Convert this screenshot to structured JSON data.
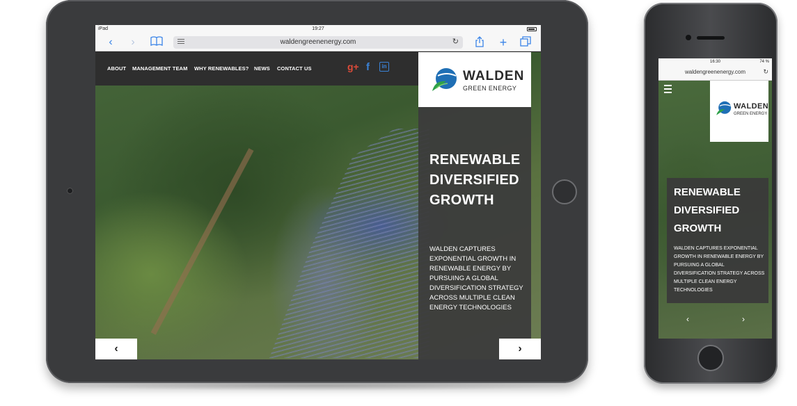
{
  "ipad": {
    "status": {
      "carrier": "iPad",
      "time": "19:27"
    },
    "toolbar": {
      "back_icon": "chevron-left-icon",
      "forward_icon": "chevron-right-icon",
      "bookmarks_icon": "book-icon",
      "url": "waldengreenenergy.com",
      "share_icon": "share-icon",
      "add_icon": "plus-icon",
      "tabs_icon": "tabs-icon"
    },
    "nav": {
      "items": [
        "ABOUT",
        "MANAGEMENT TEAM",
        "WHY RENEWABLES?",
        "NEWS",
        "CONTACT US"
      ],
      "social": [
        "g+",
        "f",
        "in"
      ]
    },
    "logo": {
      "name": "WALDEN",
      "tagline": "GREEN ENERGY"
    },
    "hero": {
      "headline_lines": [
        "RENEWABLE",
        "DIVERSIFIED",
        "GROWTH"
      ],
      "blurb": "WALDEN CAPTURES EXPONENTIAL GROWTH IN RENEWABLE ENERGY BY PURSUING A GLOBAL DIVERSIFICATION STRATEGY ACROSS MULTIPLE CLEAN ENERGY TECHNOLOGIES",
      "prev": "‹",
      "next": "›"
    }
  },
  "iphone": {
    "status": {
      "time": "16:30",
      "battery": "74 %"
    },
    "url": "waldengreenenergy.com",
    "logo": {
      "name": "WALDEN",
      "tagline": "GREEN ENERGY"
    },
    "hero": {
      "headline_lines": [
        "RENEWABLE",
        "DIVERSIFIED",
        "GROWTH"
      ],
      "blurb": "WALDEN CAPTURES EXPONENTIAL GROWTH IN RENEWABLE ENERGY BY PURSUING A GLOBAL DIVERSIFICATION STRATEGY ACROSS MULTIPLE CLEAN ENERGY TECHNOLOGIES",
      "prev": "‹",
      "next": "›"
    }
  },
  "colors": {
    "safari_blue": "#3a84e8",
    "google_plus": "#dd4b39",
    "facebook": "#3b82d6",
    "linkedin": "#3b82d6",
    "logo_blue": "#1f6fb5",
    "logo_green": "#2fa14a",
    "panel_gray": "#3c3c3c"
  }
}
